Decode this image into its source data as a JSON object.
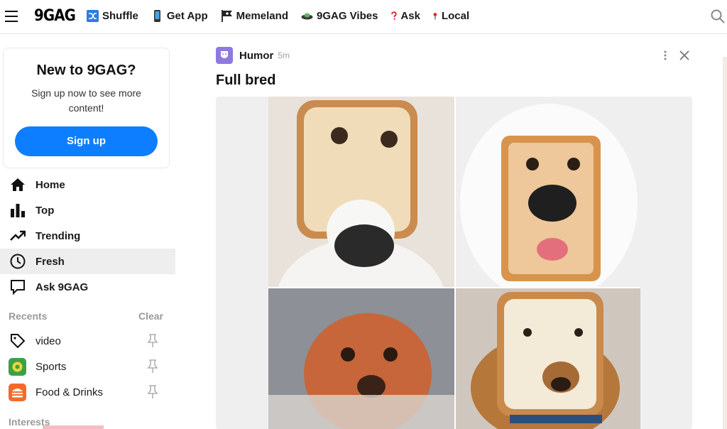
{
  "header": {
    "logo": "9GAG",
    "nav": [
      {
        "label": "Shuffle",
        "icon": "shuffle-icon"
      },
      {
        "label": "Get App",
        "icon": "phone-icon"
      },
      {
        "label": "Memeland",
        "icon": "pirate-flag-icon"
      },
      {
        "label": "9GAG Vibes",
        "icon": "ufo-icon"
      },
      {
        "label": "Ask",
        "icon": "question-icon"
      },
      {
        "label": "Local",
        "icon": "pin-icon"
      }
    ]
  },
  "signup": {
    "title": "New to 9GAG?",
    "text": "Sign up now to see more content!",
    "button": "Sign up"
  },
  "menu": [
    {
      "label": "Home",
      "icon": "home-icon"
    },
    {
      "label": "Top",
      "icon": "bar-chart-icon"
    },
    {
      "label": "Trending",
      "icon": "trending-icon"
    },
    {
      "label": "Fresh",
      "icon": "clock-icon",
      "active": true
    },
    {
      "label": "Ask 9GAG",
      "icon": "speech-bubble-icon"
    }
  ],
  "recents": {
    "title": "Recents",
    "clear": "Clear",
    "items": [
      {
        "label": "video",
        "icon": "tag-icon"
      },
      {
        "label": "Sports",
        "icon": "soccer-icon",
        "color": "#3aa14a"
      },
      {
        "label": "Food & Drinks",
        "icon": "food-icon",
        "color": "#f26b2a"
      }
    ]
  },
  "interests_title": "Interests",
  "post": {
    "section": "Humor",
    "time": "5m",
    "title": "Full bred"
  },
  "colors": {
    "accent": "#0d7eff",
    "humor_avatar": "#8f79e0"
  }
}
